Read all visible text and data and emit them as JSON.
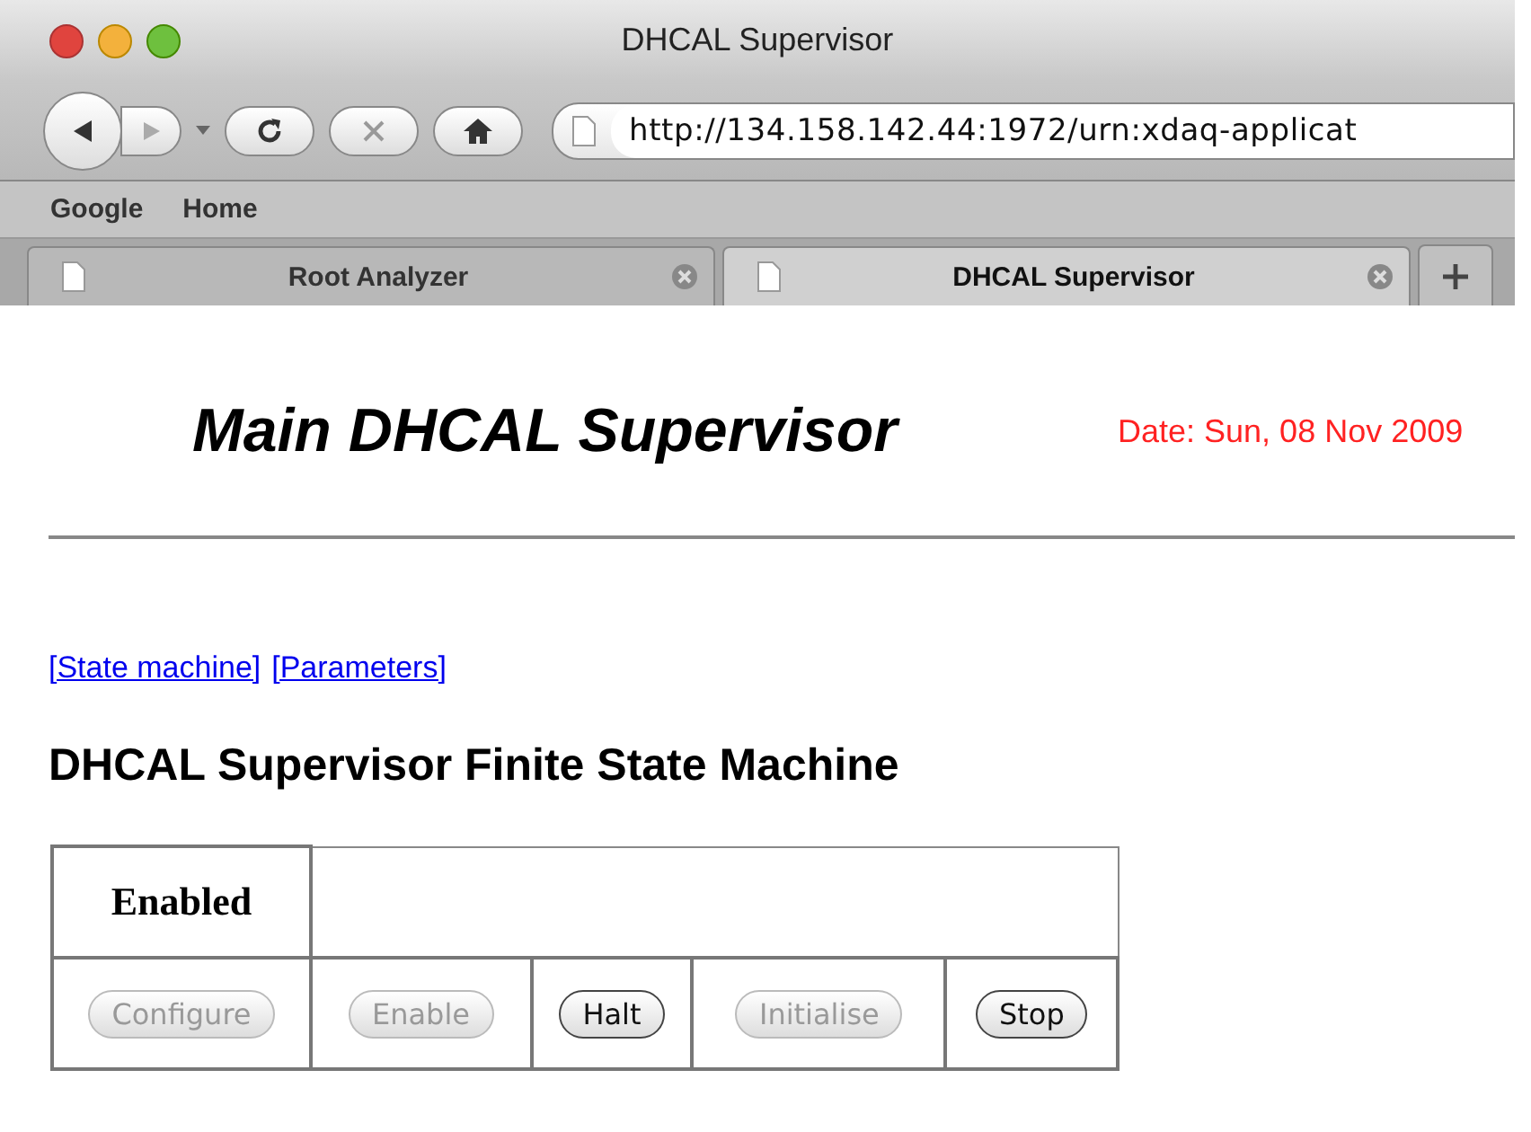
{
  "window": {
    "title": "DHCAL Supervisor"
  },
  "toolbar": {
    "url": "http://134.158.142.44:1972/urn:xdaq-applicat"
  },
  "bookmarks": [
    "Google",
    "Home"
  ],
  "tabs": [
    {
      "label": "Root Analyzer",
      "selected": false
    },
    {
      "label": "DHCAL Supervisor",
      "selected": true
    }
  ],
  "page": {
    "heading": "Main DHCAL Supervisor",
    "date": "Date: Sun, 08 Nov 2009",
    "links": [
      "[State machine]",
      "[Parameters]"
    ],
    "section_title": "DHCAL Supervisor Finite State Machine",
    "state": "Enabled",
    "buttons": [
      {
        "label": "Configure",
        "disabled": true
      },
      {
        "label": "Enable",
        "disabled": true
      },
      {
        "label": "Halt",
        "disabled": false
      },
      {
        "label": "Initialise",
        "disabled": true
      },
      {
        "label": "Stop",
        "disabled": false
      }
    ]
  }
}
